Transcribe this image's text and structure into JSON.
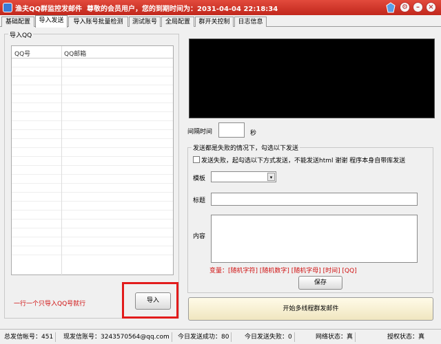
{
  "window": {
    "title": "渔夫QQ群监控发邮件",
    "subtitle": "尊敬的会员用户，您的到期时间为：2031-04-04 22:18:34"
  },
  "tabs": [
    "基础配置",
    "导入发送",
    "导入账号批量检测",
    "测试账号",
    "全局配置",
    "群开关控制",
    "日志信息"
  ],
  "import_panel": {
    "group_title": "导入QQ",
    "columns": [
      "QQ号",
      "QQ邮箱"
    ],
    "hint": "一行一个只导入QQ号就行",
    "import_button": "导入"
  },
  "send_panel": {
    "interval_label": "间隔时间",
    "interval_value": "",
    "interval_unit": "秒",
    "fail_group_title": "发送都是失败的情况下，勾选以下发送",
    "fail_checkbox_label": "发送失败，起勾选以下方式发送，不能发送html 谢谢 程序本身自带库发送",
    "fail_checkbox_checked": false,
    "template_label": "模板",
    "template_value": "",
    "subject_label": "标题",
    "content_label": "内容",
    "variables": "变量：[随机字符] [随机数字] [随机字母] [时间] [QQ]",
    "save_button": "保存",
    "start_button": "开始多线程群发邮件"
  },
  "status_bar": {
    "sender_count": "总发信帐号：451",
    "current_sender": "现发信账号：3243570564@qq.com",
    "today_success": "今日发送成功：80",
    "today_fail": "今日发送失败：0",
    "network": "网络状态：真",
    "auth": "授权状态：真"
  },
  "colors": {
    "titlebar": "#c9271d",
    "hint_text": "#d01010",
    "highlight_box": "#e21b1b"
  }
}
